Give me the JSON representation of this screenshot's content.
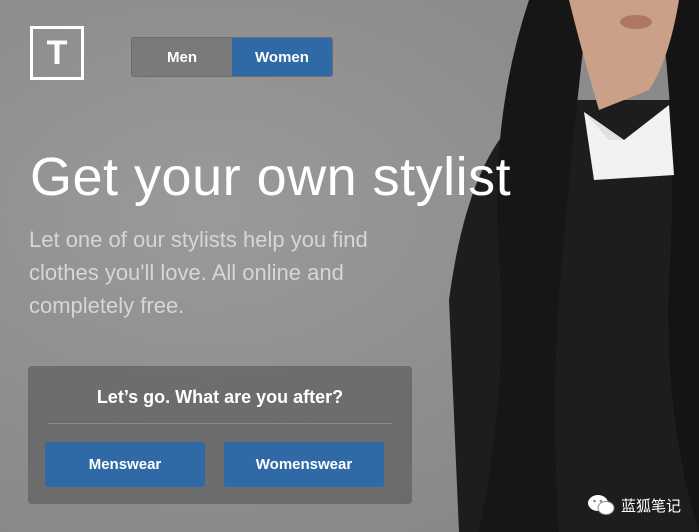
{
  "brand": {
    "logo_letter": "T"
  },
  "toggle": {
    "men_label": "Men",
    "women_label": "Women",
    "selected": "Women"
  },
  "hero": {
    "headline": "Get your own stylist",
    "subtext": "Let one of our stylists help you find clothes you'll love. All online and completely free."
  },
  "panel": {
    "title": "Let’s go. What are you after?",
    "menswear_label": "Menswear",
    "womenswear_label": "Womenswear"
  },
  "watermark": {
    "text": "蓝狐笔记"
  },
  "colors": {
    "accent": "#2f6aa6",
    "panel": "#5f5f5f"
  }
}
